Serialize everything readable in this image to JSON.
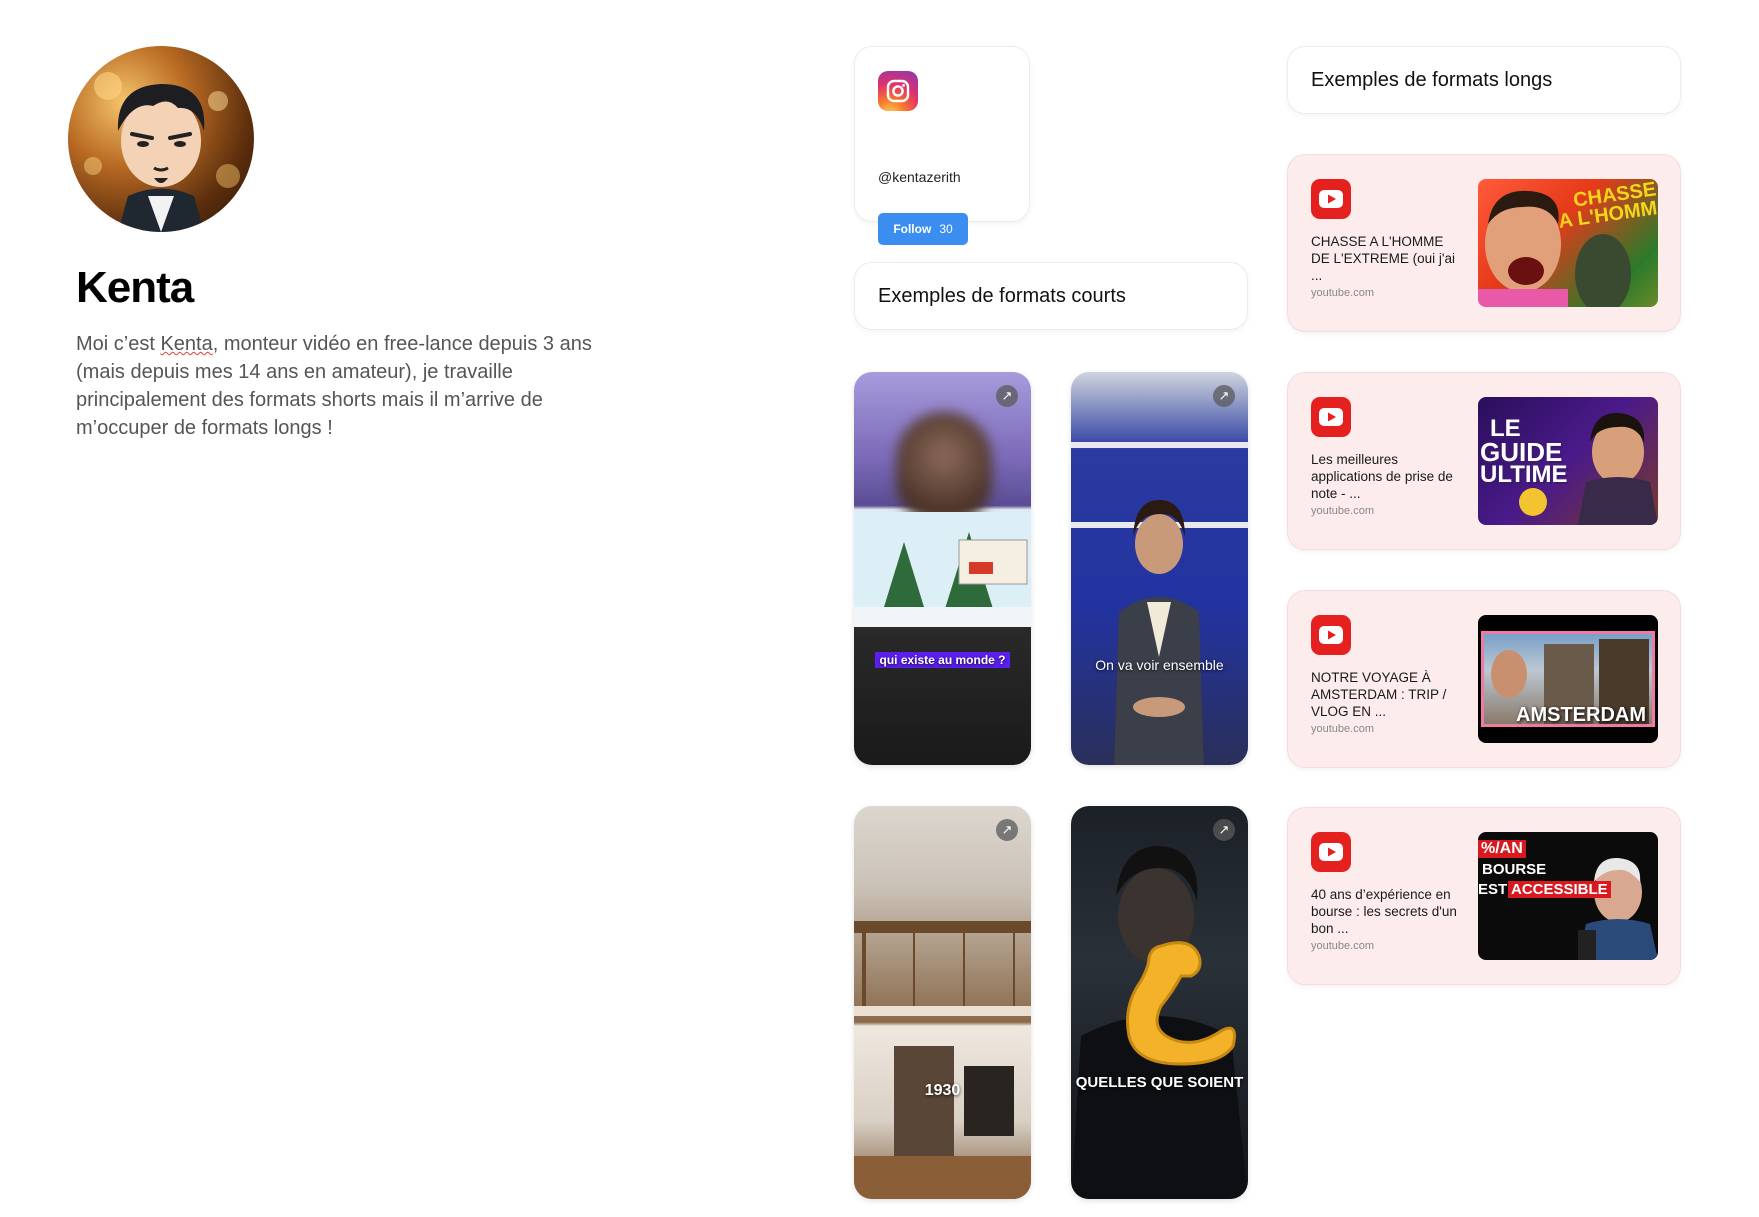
{
  "profile": {
    "name": "Kenta",
    "bio_parts": [
      "Moi c’est ",
      "Kenta",
      ", monteur vidéo en free-lance depuis 3 ans (mais depuis mes 14 ans en amateur), je travaille principalement des formats shorts mais il m’arrive de m’occuper de formats longs !"
    ]
  },
  "instagram": {
    "icon": "instagram-icon",
    "handle": "@kentazerith",
    "follow_label": "Follow",
    "follow_count": "30"
  },
  "sections": {
    "short_title": "Exemples de formats courts",
    "long_title": "Exemples de formats longs"
  },
  "shorts": [
    {
      "caption": "qui existe au monde ?",
      "icon": "external-link-icon"
    },
    {
      "caption": "On va voir ensemble",
      "icon": "external-link-icon"
    },
    {
      "caption": "1930",
      "icon": "external-link-icon"
    },
    {
      "caption": "QUELLES QUE SOIENT",
      "icon": "external-link-icon"
    }
  ],
  "longs": [
    {
      "title": "CHASSE A L'HOMME DE L'EXTREME (oui j'ai ...",
      "domain": "youtube.com",
      "thumb_text": [
        "CHASSE",
        "A L'HOMM"
      ]
    },
    {
      "title": "Les meilleures applications de prise de note - ...",
      "domain": "youtube.com",
      "thumb_text": [
        "LE",
        "GUIDE",
        "ULTIME"
      ]
    },
    {
      "title": "NOTRE VOYAGE À AMSTERDAM : TRIP / VLOG EN ...",
      "domain": "youtube.com",
      "thumb_text": [
        "AMSTERDAM"
      ]
    },
    {
      "title": "40 ans d’expérience en bourse : les secrets d'un bon ...",
      "domain": "youtube.com",
      "thumb_text": [
        "%/AN",
        "BOURSE",
        "EST",
        "ACCESSIBLE"
      ]
    }
  ],
  "colors": {
    "follow_button": "#3b8df0",
    "youtube_red": "#e4211e",
    "youtube_card_bg": "#fdecec"
  }
}
